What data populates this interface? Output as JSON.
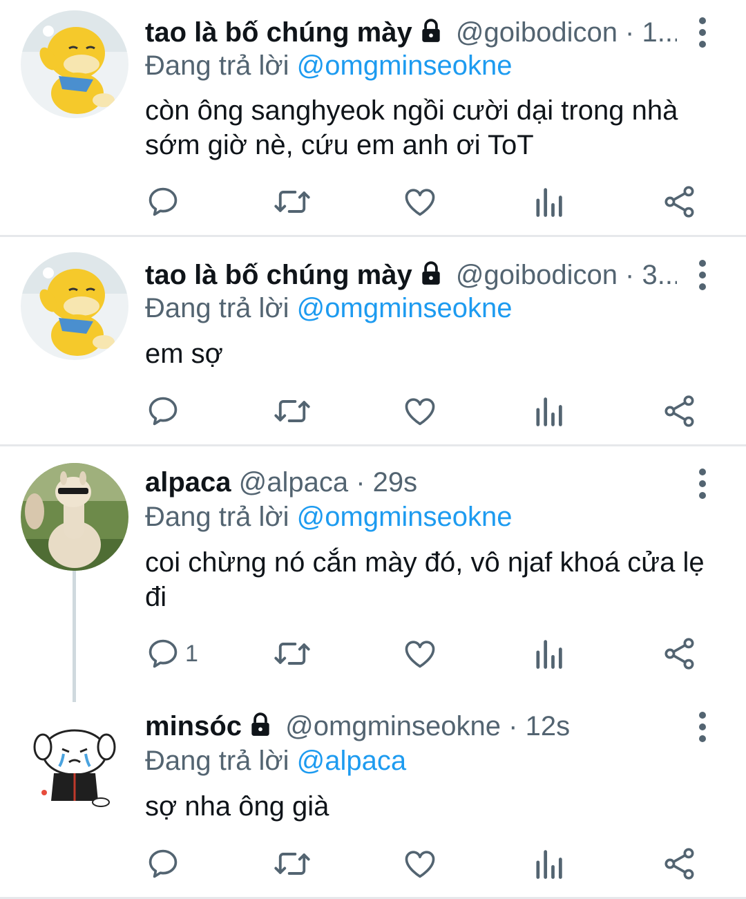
{
  "tweets": [
    {
      "name": "tao là bố chúng mày",
      "handle": "@goibodicon · 1...",
      "protected": true,
      "reply_label": "Đang trả lời",
      "reply_to": "@omgminseokne",
      "text": "còn ông sanghyeok ngồi cười dại trong nhà sớm giờ nè, cứu em anh ơi ToT",
      "reply_count": "",
      "avatar": "psyduck-avatar"
    },
    {
      "name": "tao là bố chúng mày",
      "handle": "@goibodicon · 3...",
      "protected": true,
      "reply_label": "Đang trả lời",
      "reply_to": "@omgminseokne",
      "text": "em sợ",
      "reply_count": "",
      "avatar": "psyduck-avatar"
    },
    {
      "name": "alpaca",
      "handle": "@alpaca · 29s",
      "protected": false,
      "reply_label": "Đang trả lời",
      "reply_to": "@omgminseokne",
      "text": "coi chừng nó cắn mày đó, vô njaf khoá cửa lẹ đi",
      "reply_count": "1",
      "avatar": "alpaca-avatar"
    },
    {
      "name": "minsóc",
      "handle": "@omgminseokne · 12s",
      "protected": true,
      "reply_label": "Đang trả lời",
      "reply_to": "@alpaca",
      "text": "sợ nha ông già",
      "reply_count": "",
      "avatar": "crying-dog-avatar"
    }
  ],
  "icons": {
    "reply": "speech-bubble-icon",
    "retweet": "retweet-icon",
    "like": "heart-icon",
    "analytics": "bar-chart-icon",
    "share": "share-icon",
    "protected": "lock-icon",
    "menu": "more-vertical-icon"
  },
  "colors": {
    "mention": "#1d9bf0",
    "secondary": "#536471",
    "divider": "#e6e8eb"
  }
}
